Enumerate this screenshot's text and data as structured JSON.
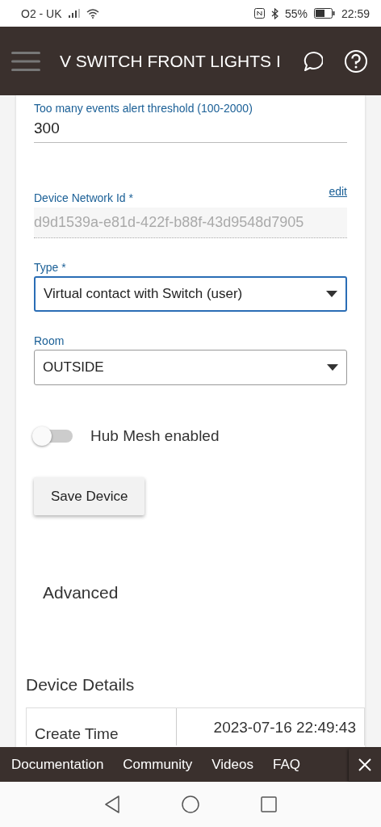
{
  "status_bar": {
    "carrier": "O2 - UK",
    "battery": "55%",
    "time": "22:59"
  },
  "app_bar": {
    "title": "V SWITCH FRONT LIGHTS I"
  },
  "fields": [
    {
      "kind": "text",
      "label": "Too many events alert threshold (100-2000)",
      "value": "300"
    },
    {
      "kind": "readonly",
      "label": "Device Network Id *",
      "value": "d9d1539a-e81d-422f-b88f-43d9548d7905",
      "action": "edit"
    },
    {
      "kind": "select",
      "label": "Type *",
      "value": "Virtual contact with Switch (user)",
      "focused": true
    },
    {
      "kind": "select",
      "label": "Room",
      "value": "OUTSIDE",
      "focused": false
    }
  ],
  "hub_mesh": {
    "label": "Hub Mesh enabled",
    "on": false
  },
  "save_button": "Save Device",
  "advanced": "Advanced",
  "details": {
    "title": "Device Details",
    "rows": [
      {
        "label": "Create Time",
        "value": "2023-07-16 22:49:43"
      }
    ]
  },
  "footer": {
    "links": [
      "Documentation",
      "Community",
      "Videos",
      "FAQ"
    ]
  }
}
